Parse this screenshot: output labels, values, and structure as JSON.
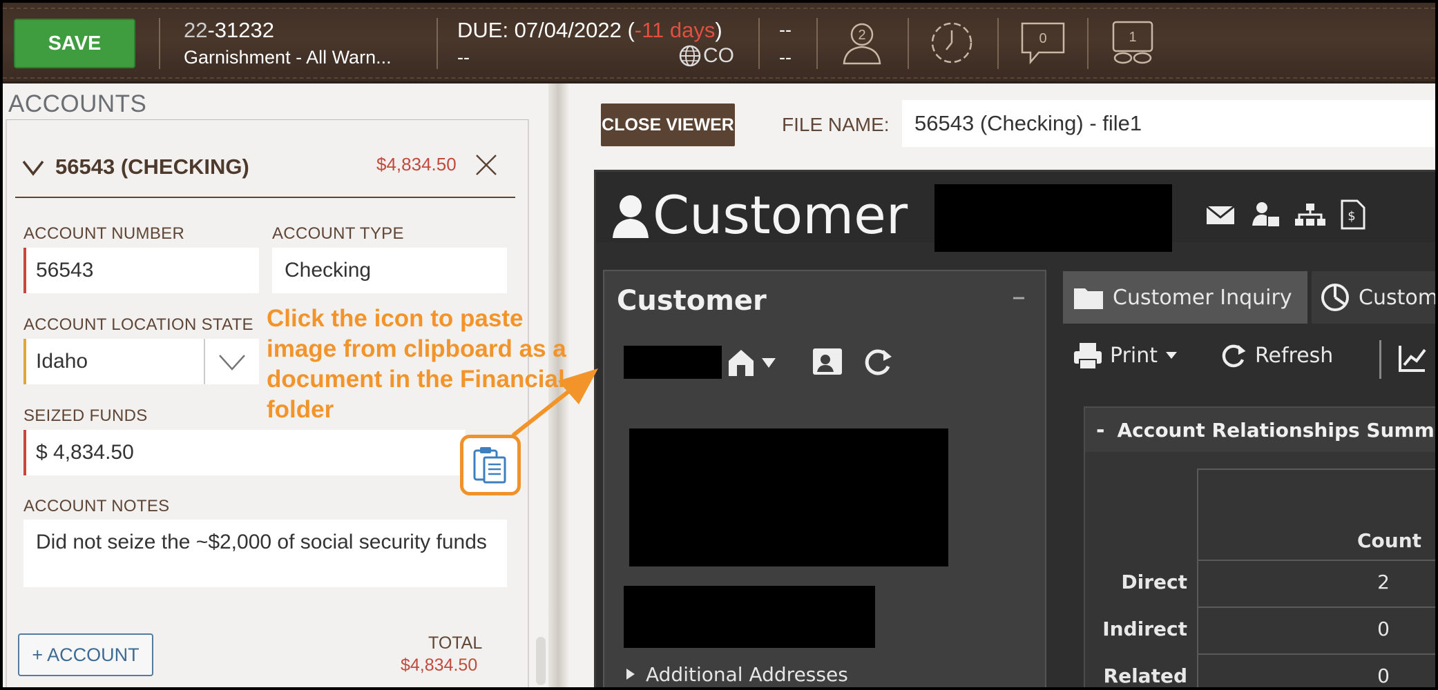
{
  "topbar": {
    "save_label": "SAVE",
    "case_prefix": "22",
    "case_suffix": "-31232",
    "case_type": "Garnishment - All Warn...",
    "due_prefix": "DUE: 07/04/2022 (",
    "due_days": "-11 days",
    "due_suffix": ")",
    "due_sub": "--",
    "state_code": "CO",
    "field_a": "--",
    "field_b": "--",
    "people_count": "2",
    "messages_count": "0",
    "linked_count": "1"
  },
  "accounts": {
    "title": "ACCOUNTS",
    "account": {
      "name": "56543 (CHECKING)",
      "amount": "$4,834.50",
      "account_number_label": "ACCOUNT NUMBER",
      "account_number": "56543",
      "account_type_label": "ACCOUNT TYPE",
      "account_type": "Checking",
      "location_state_label": "ACCOUNT LOCATION STATE",
      "location_state": "Idaho",
      "seized_funds_label": "SEIZED FUNDS",
      "seized_funds": "$ 4,834.50",
      "notes_label": "ACCOUNT NOTES",
      "notes": "Did not seize the ~$2,000 of social security funds"
    },
    "add_account_label": "+ ACCOUNT",
    "total_label": "TOTAL",
    "total_value": "$4,834.50"
  },
  "annotation": {
    "text": "Click the icon to paste image from clipboard as a document in the Financial folder"
  },
  "viewer": {
    "close_label": "CLOSE VIEWER",
    "file_name_label": "FILE NAME:",
    "file_name": "56543 (Checking) - file1",
    "document": {
      "header_title": "Customer",
      "panel_title": "Customer",
      "panel_collapse": "–",
      "additional_addresses": "Additional Addresses",
      "tab_inquiry": "Customer Inquiry",
      "tab_partial": "Custom",
      "print_label": "Print",
      "refresh_label": "Refresh",
      "summary_title": "Account Relationships Summa",
      "count_header": "Count",
      "rows": [
        {
          "label": "Direct",
          "count": "2"
        },
        {
          "label": "Indirect",
          "count": "0"
        },
        {
          "label": "Related",
          "count": "0"
        }
      ]
    }
  },
  "colors": {
    "save_green": "#3f9d3f",
    "alert_red": "#c24a3c",
    "annotation_orange": "#f2942a",
    "brown_header": "#4a372b",
    "field_required": "#c9473a",
    "field_warning": "#e0a83a"
  }
}
